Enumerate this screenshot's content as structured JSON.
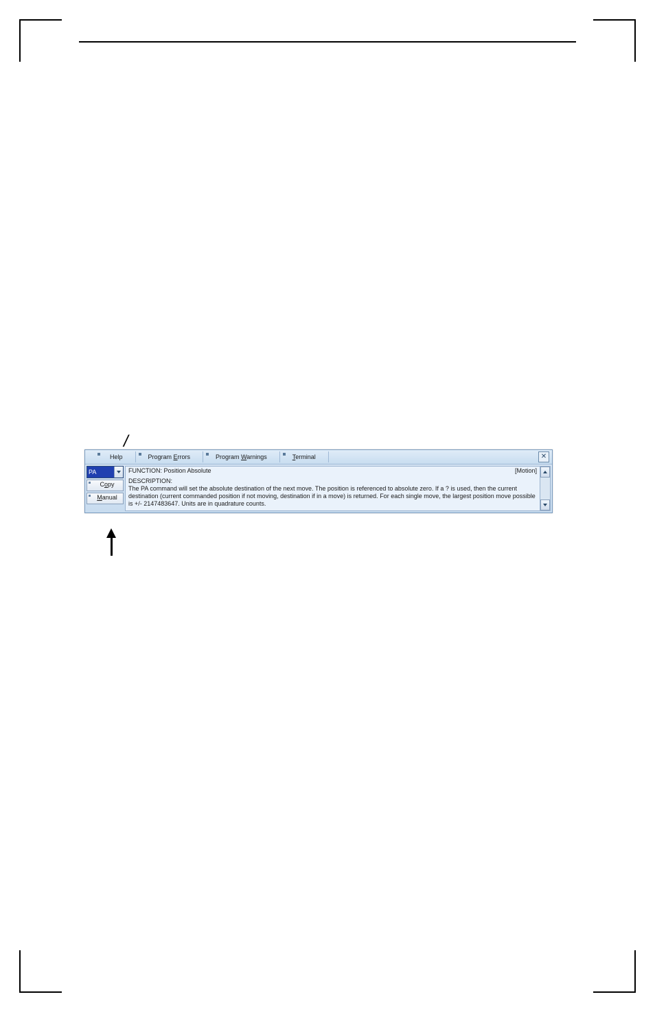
{
  "tabs": {
    "help": "Help",
    "program_errors_pre": "Program ",
    "program_errors_u": "E",
    "program_errors_post": "rrors",
    "program_warnings_pre": "Program ",
    "program_warnings_u": "W",
    "program_warnings_post": "arnings",
    "terminal_u": "T",
    "terminal_post": "erminal"
  },
  "combo": {
    "value": "PA"
  },
  "buttons": {
    "copy_pre": "C",
    "copy_u": "o",
    "copy_post": "py",
    "manual_u": "M",
    "manual_post": "anual"
  },
  "help_text": {
    "func_label": "FUNCTION:",
    "func_value": " Position Absolute",
    "category": "[Motion]",
    "desc_label": "DESCRIPTION:",
    "desc_body": "The PA command will set the absolute destination of the next move.  The position is referenced to absolute zero.  If a ? is used, then the current destination (current commanded position if not moving, destination if in a move) is returned.  For each single move, the largest position move possible is +/- 2147483647.  Units are in quadrature counts."
  }
}
